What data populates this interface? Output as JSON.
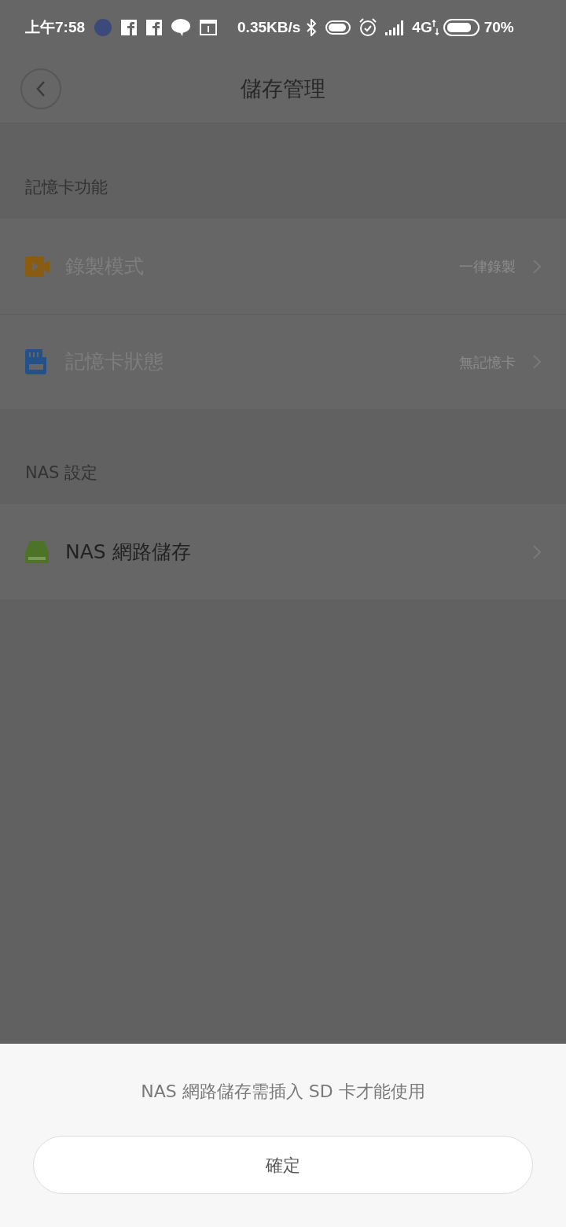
{
  "status_bar": {
    "time": "上午7:58",
    "network_speed": "0.35KB/s",
    "network_type": "4G",
    "battery": "70%"
  },
  "header": {
    "title": "儲存管理"
  },
  "sections": [
    {
      "title": "記憶卡功能",
      "items": [
        {
          "kind": "video",
          "label": "錄製模式",
          "value": "一律錄製",
          "disabled": true
        },
        {
          "kind": "sd-card",
          "label": "記憶卡狀態",
          "value": "無記憶卡",
          "disabled": true
        }
      ]
    },
    {
      "title": "NAS 設定",
      "items": [
        {
          "kind": "nas",
          "label": "NAS 網路儲存",
          "disabled": false
        }
      ]
    }
  ],
  "dialog": {
    "message": "NAS 網路儲存需插入 SD 卡才能使用",
    "button": "確定"
  }
}
